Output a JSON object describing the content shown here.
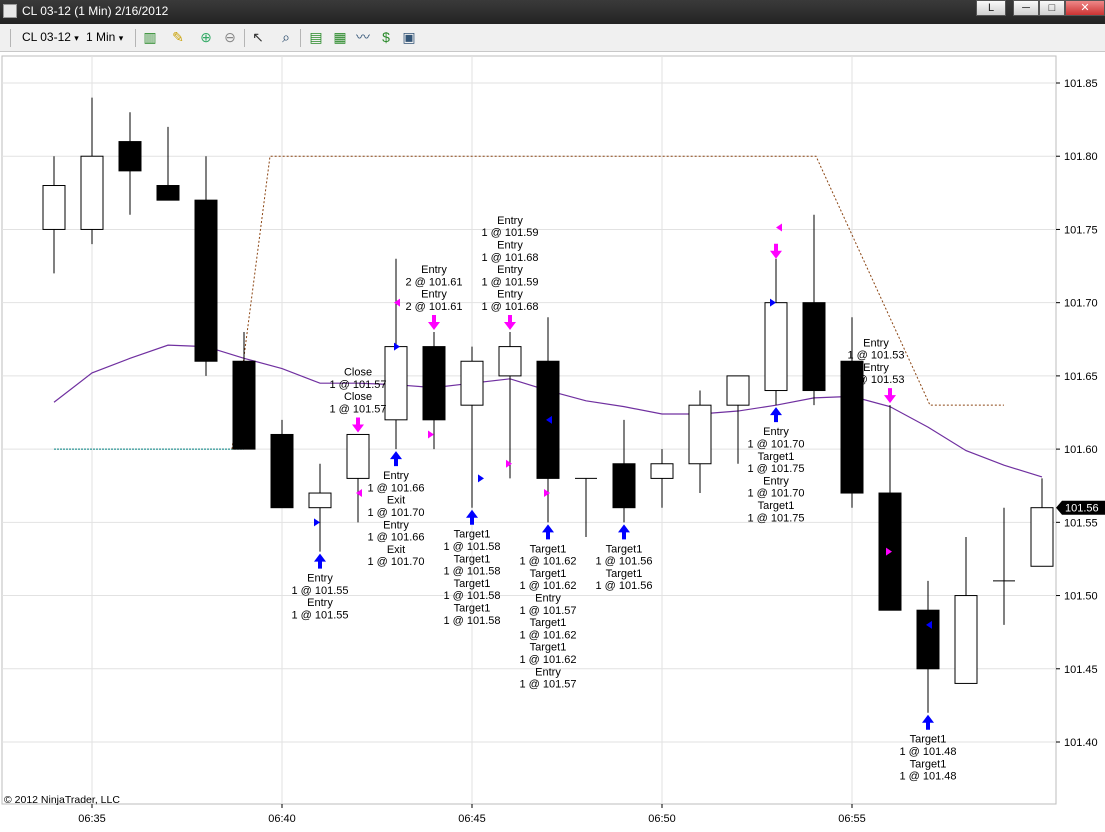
{
  "window": {
    "title": "CL 03-12 (1 Min)  2/16/2012",
    "left_btn": "L",
    "minimize": "─",
    "maximize": "□",
    "close": "✕"
  },
  "toolbar": {
    "instrument": "CL 03-12",
    "interval": "1 Min",
    "dropdown_glyph": "▾",
    "icons": [
      "candlestick-style-icon",
      "drawing-pencil-icon",
      "zoom-in-icon",
      "zoom-out-icon",
      "cursor-pointer-icon",
      "magnifier-icon",
      "bar-data-icon",
      "chart-style-icon",
      "indicator-icon",
      "strategy-icon",
      "properties-icon"
    ]
  },
  "colors": {
    "sma": "#7030a0",
    "stop_line": "#8b4513",
    "teal_line": "#008080",
    "buy_arrow": "#0000ff",
    "sell_arrow": "#ff00ff",
    "price_tag_bg": "#000000"
  },
  "chart_data": {
    "type": "candlestick",
    "y_ticks": [
      "101.85",
      "101.80",
      "101.75",
      "101.70",
      "101.65",
      "101.60",
      "101.55",
      "101.50",
      "101.45",
      "101.40"
    ],
    "x_ticks": [
      "06:35",
      "06:40",
      "06:45",
      "06:50",
      "06:55"
    ],
    "ylim": [
      101.35,
      101.87
    ],
    "last_price": "101.56",
    "copyright": "© 2012 NinjaTrader, LLC",
    "candles": [
      {
        "t": "06:34",
        "o": 101.75,
        "h": 101.8,
        "l": 101.72,
        "c": 101.78
      },
      {
        "t": "06:35",
        "o": 101.75,
        "h": 101.84,
        "l": 101.74,
        "c": 101.8
      },
      {
        "t": "06:36",
        "o": 101.81,
        "h": 101.83,
        "l": 101.76,
        "c": 101.79
      },
      {
        "t": "06:37",
        "o": 101.78,
        "h": 101.82,
        "l": 101.77,
        "c": 101.77
      },
      {
        "t": "06:38",
        "o": 101.77,
        "h": 101.8,
        "l": 101.65,
        "c": 101.66
      },
      {
        "t": "06:39",
        "o": 101.66,
        "h": 101.68,
        "l": 101.6,
        "c": 101.6
      },
      {
        "t": "06:40",
        "o": 101.61,
        "h": 101.62,
        "l": 101.56,
        "c": 101.56
      },
      {
        "t": "06:41",
        "o": 101.56,
        "h": 101.59,
        "l": 101.53,
        "c": 101.57
      },
      {
        "t": "06:42",
        "o": 101.58,
        "h": 101.61,
        "l": 101.55,
        "c": 101.61
      },
      {
        "t": "06:43",
        "o": 101.62,
        "h": 101.73,
        "l": 101.6,
        "c": 101.67
      },
      {
        "t": "06:44",
        "o": 101.67,
        "h": 101.68,
        "l": 101.6,
        "c": 101.62
      },
      {
        "t": "06:45",
        "o": 101.63,
        "h": 101.67,
        "l": 101.56,
        "c": 101.66
      },
      {
        "t": "06:46",
        "o": 101.65,
        "h": 101.68,
        "l": 101.58,
        "c": 101.67
      },
      {
        "t": "06:47",
        "o": 101.66,
        "h": 101.69,
        "l": 101.55,
        "c": 101.58
      },
      {
        "t": "06:48",
        "o": 101.58,
        "h": 101.58,
        "l": 101.54,
        "c": 101.58
      },
      {
        "t": "06:49",
        "o": 101.59,
        "h": 101.62,
        "l": 101.55,
        "c": 101.56
      },
      {
        "t": "06:50",
        "o": 101.58,
        "h": 101.6,
        "l": 101.56,
        "c": 101.59
      },
      {
        "t": "06:51",
        "o": 101.59,
        "h": 101.64,
        "l": 101.57,
        "c": 101.63
      },
      {
        "t": "06:52",
        "o": 101.63,
        "h": 101.65,
        "l": 101.59,
        "c": 101.65
      },
      {
        "t": "06:53",
        "o": 101.64,
        "h": 101.73,
        "l": 101.63,
        "c": 101.7
      },
      {
        "t": "06:54",
        "o": 101.7,
        "h": 101.76,
        "l": 101.63,
        "c": 101.64
      },
      {
        "t": "06:55",
        "o": 101.66,
        "h": 101.69,
        "l": 101.56,
        "c": 101.57
      },
      {
        "t": "06:56",
        "o": 101.57,
        "h": 101.63,
        "l": 101.49,
        "c": 101.49
      },
      {
        "t": "06:57",
        "o": 101.49,
        "h": 101.51,
        "l": 101.42,
        "c": 101.45
      },
      {
        "t": "06:58",
        "o": 101.44,
        "h": 101.54,
        "l": 101.44,
        "c": 101.5
      },
      {
        "t": "06:59",
        "o": 101.51,
        "h": 101.56,
        "l": 101.48,
        "c": 101.51
      },
      {
        "t": "07:00",
        "o": 101.52,
        "h": 101.58,
        "l": 101.52,
        "c": 101.56
      }
    ],
    "sma": [
      101.632,
      101.652,
      101.662,
      101.671,
      101.67,
      101.662,
      101.655,
      101.645,
      101.645,
      101.644,
      101.642,
      101.645,
      101.648,
      101.64,
      101.633,
      101.629,
      101.624,
      101.624,
      101.626,
      101.63,
      101.635,
      101.636,
      101.629,
      101.615,
      101.599,
      101.589,
      101.581
    ],
    "stop_line": [
      [
        101.6,
        101.6
      ],
      [
        101.8,
        101.8
      ],
      [
        101.8,
        101.8
      ],
      [
        101.63,
        101.63
      ]
    ],
    "labels": [
      {
        "bar": 8,
        "pos": "above",
        "lines": [
          "Close",
          "1 @ 101.57",
          "Close",
          "1 @ 101.57"
        ]
      },
      {
        "bar": 10,
        "pos": "above",
        "lines": [
          "Entry",
          "2 @ 101.61",
          "Entry",
          "2 @ 101.61"
        ]
      },
      {
        "bar": 12,
        "pos": "above",
        "lines": [
          "Entry",
          "1 @ 101.59",
          "Entry",
          "1 @ 101.68",
          "Entry",
          "1 @ 101.59",
          "Entry",
          "1 @ 101.68"
        ]
      },
      {
        "bar": 22,
        "pos": "above",
        "lines": [
          "Entry",
          "1 @ 101.53",
          "Entry",
          "1 @ 101.53"
        ]
      },
      {
        "bar": 7,
        "pos": "below",
        "lines": [
          "Entry",
          "1 @ 101.55",
          "Entry",
          "1 @ 101.55"
        ]
      },
      {
        "bar": 9,
        "pos": "below",
        "lines": [
          "Entry",
          "1 @ 101.66",
          "Exit",
          "1 @ 101.70",
          "Entry",
          "1 @ 101.66",
          "Exit",
          "1 @ 101.70"
        ]
      },
      {
        "bar": 11,
        "pos": "below",
        "lines": [
          "Target1",
          "1 @ 101.58",
          "Target1",
          "1 @ 101.58",
          "Target1",
          "1 @ 101.58",
          "Target1",
          "1 @ 101.58"
        ]
      },
      {
        "bar": 13,
        "pos": "below",
        "lines": [
          "Target1",
          "1 @ 101.62",
          "Target1",
          "1 @ 101.62",
          "Entry",
          "1 @ 101.57",
          "Target1",
          "1 @ 101.62",
          "Target1",
          "1 @ 101.62",
          "Entry",
          "1 @ 101.57"
        ]
      },
      {
        "bar": 15,
        "pos": "below",
        "lines": [
          "Target1",
          "1 @ 101.56",
          "Target1",
          "1 @ 101.56"
        ]
      },
      {
        "bar": 19,
        "pos": "below",
        "lines": [
          "Entry",
          "1 @ 101.70",
          "Target1",
          "1 @ 101.75",
          "Entry",
          "1 @ 101.70",
          "Target1",
          "1 @ 101.75"
        ]
      },
      {
        "bar": 23,
        "pos": "below",
        "lines": [
          "Target1",
          "1 @ 101.48",
          "Target1",
          "1 @ 101.48"
        ]
      }
    ]
  }
}
